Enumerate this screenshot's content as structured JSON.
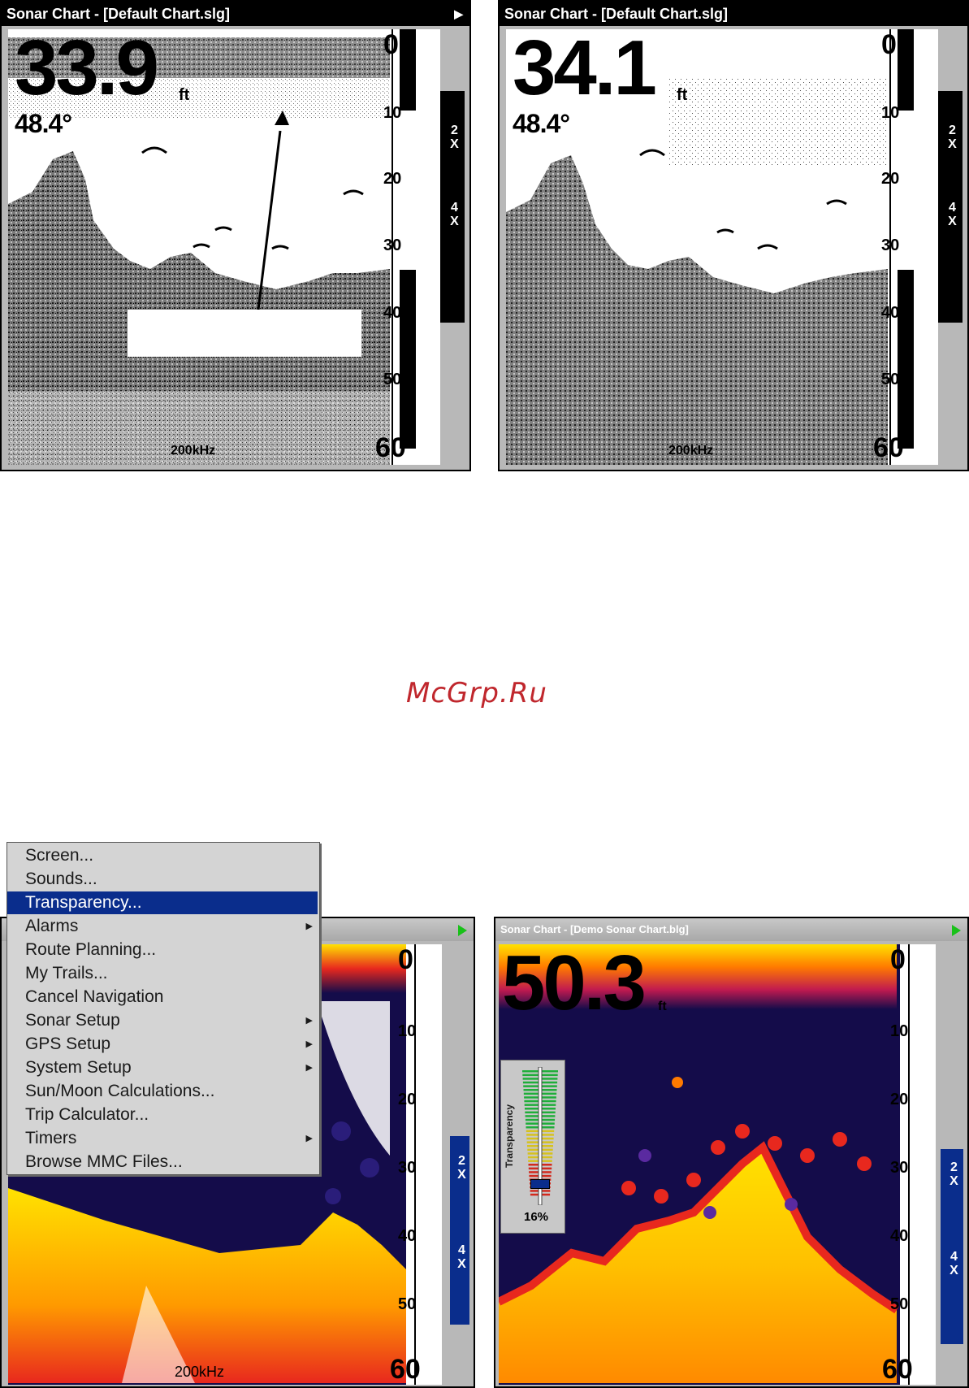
{
  "top_left": {
    "title": "Sonar Chart - [Default Chart.slg]",
    "depth": "33.9",
    "depth_unit": "ft",
    "temperature": "48.4°",
    "frequency": "200kHz",
    "scale": [
      "0",
      "10",
      "20",
      "30",
      "40",
      "50",
      "60"
    ],
    "zoom": [
      "2X",
      "4X"
    ]
  },
  "top_right": {
    "title": "Sonar Chart - [Default Chart.slg]",
    "depth": "34.1",
    "depth_unit": "ft",
    "temperature": "48.4°",
    "frequency": "200kHz",
    "scale": [
      "0",
      "10",
      "20",
      "30",
      "40",
      "50",
      "60"
    ],
    "zoom": [
      "2X",
      "4X"
    ]
  },
  "watermark": "McGrp.Ru",
  "bottom_left": {
    "menu": {
      "items": [
        {
          "label": "Screen...",
          "submenu": false
        },
        {
          "label": "Sounds...",
          "submenu": false
        },
        {
          "label": "Transparency...",
          "submenu": false
        },
        {
          "label": "Alarms",
          "submenu": true
        },
        {
          "label": "Route Planning...",
          "submenu": false
        },
        {
          "label": "My Trails...",
          "submenu": false
        },
        {
          "label": "Cancel Navigation",
          "submenu": false
        },
        {
          "label": "Sonar Setup",
          "submenu": true
        },
        {
          "label": "GPS Setup",
          "submenu": true
        },
        {
          "label": "System Setup",
          "submenu": true
        },
        {
          "label": "Sun/Moon Calculations...",
          "submenu": false
        },
        {
          "label": "Trip Calculator...",
          "submenu": false
        },
        {
          "label": "Timers",
          "submenu": true
        },
        {
          "label": "Browse MMC Files...",
          "submenu": false
        }
      ],
      "selected_index": 2
    },
    "frequency": "200kHz",
    "scale": [
      "0",
      "10",
      "20",
      "30",
      "40",
      "50",
      "60"
    ],
    "zoom": [
      "2X",
      "4X"
    ]
  },
  "bottom_right": {
    "title": "Sonar Chart - [Demo Sonar Chart.blg]",
    "depth": "50.3",
    "depth_unit": "ft",
    "transparency_label": "Transparency",
    "transparency_value": "16%",
    "transparency_level": 0.16,
    "scale": [
      "0",
      "10",
      "20",
      "30",
      "40",
      "50",
      "60"
    ],
    "zoom": [
      "2X",
      "4X"
    ]
  },
  "colors": {
    "menu_highlight": "#0a2d8c",
    "zoom_bar_color": "#0a2d8c",
    "sonar_yellow": "#ffe200",
    "sonar_red": "#e8281e",
    "sonar_navy": "#140c4a",
    "watermark": "#c0272d",
    "play_icon": "#19c119"
  }
}
